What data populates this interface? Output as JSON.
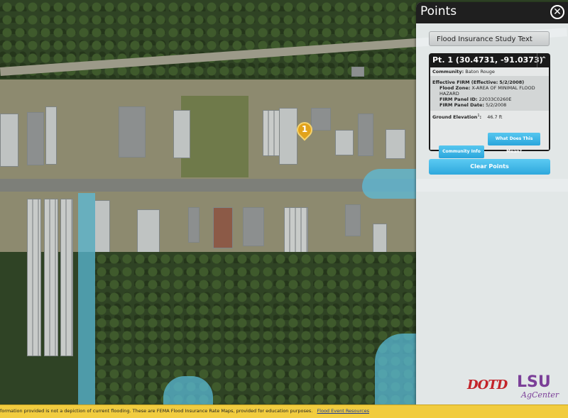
{
  "panel": {
    "title": "Points",
    "close_icon": "close-icon",
    "flood_study_button": "Flood Insurance Study Text",
    "clear_points_button": "Clear Points"
  },
  "point": {
    "header": "Pt. 1 (30.4731, -91.0373)",
    "community_label": "Community:",
    "community_value": "Baton Rouge",
    "effective_firm_label": "Effective FIRM (Effective:",
    "effective_firm_value": "5/2/2008)",
    "flood_zone_label": "Flood Zone:",
    "flood_zone_value": "X-AREA OF MINIMAL FLOOD HAZARD",
    "panel_id_label": "FIRM Panel ID:",
    "panel_id_value": "22033C0260E",
    "panel_date_label": "FIRM Panel Date:",
    "panel_date_value": "5/2/2008",
    "ground_elev_label": "Ground Elevation",
    "ground_elev_sup": "1",
    "ground_elev_colon": ":",
    "ground_elev_value": "46.7 ft",
    "community_info_button": "Community Info",
    "what_mean_button": "What Does This Mean?",
    "collapse_icon": "chevron-up-icon"
  },
  "marker": {
    "number": "1"
  },
  "logos": {
    "dotd": "DOTD",
    "lsu": "LSU",
    "agcenter": "AgCenter"
  },
  "bottom_bar": {
    "text": "formation provided is not a depiction of current flooding. These are FEMA Flood Insurance Rate Maps, provided for education purposes.",
    "link": "Flood Event Resources"
  }
}
